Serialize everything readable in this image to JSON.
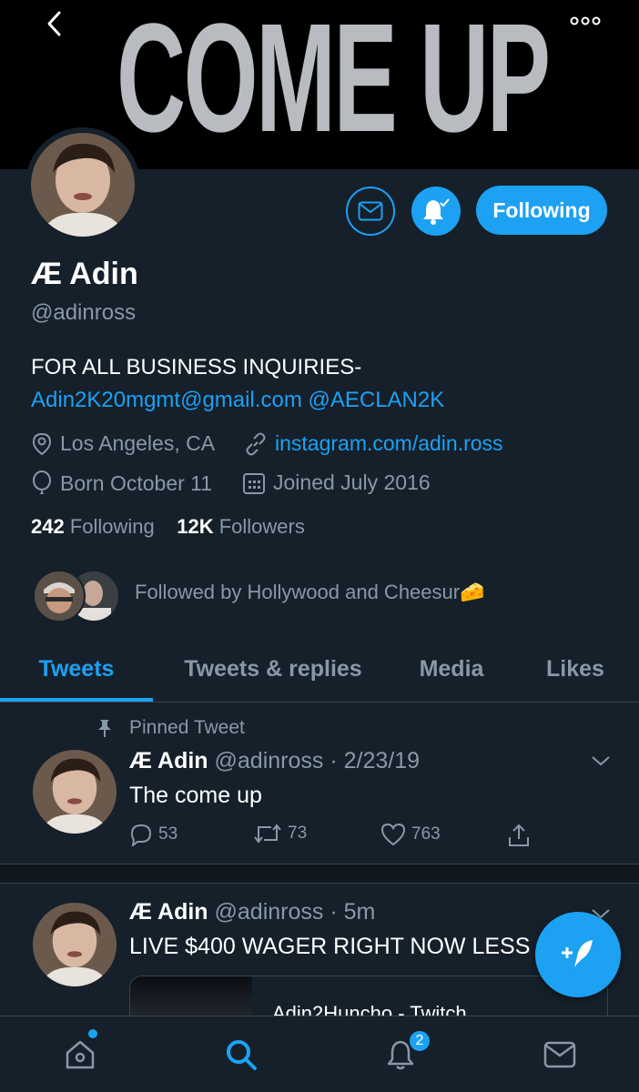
{
  "banner": {
    "text": "COME UP"
  },
  "profile": {
    "name": "Æ Adin",
    "handle": "@adinross",
    "follow_label": "Following",
    "bio_line1": "FOR ALL BUSINESS INQUIRIES-",
    "bio_email": "Adin2K20mgmt@gmail.com",
    "bio_mention": "@AECLAN2K",
    "location": "Los Angeles, CA",
    "website": "instagram.com/adin.ross",
    "birthday": "Born October 11",
    "joined": "Joined July 2016",
    "following_count": "242",
    "following_label": "Following",
    "followers_count": "12K",
    "followers_label": "Followers",
    "followed_by": "Followed by Hollywood and Cheesur🧀"
  },
  "tabs": [
    {
      "label": "Tweets"
    },
    {
      "label": "Tweets & replies"
    },
    {
      "label": "Media"
    },
    {
      "label": "Likes"
    }
  ],
  "tweets": [
    {
      "pinned_label": "Pinned Tweet",
      "name": "Æ Adin",
      "handle_time": "@adinross · 2/23/19",
      "text": "The come up",
      "replies": "53",
      "retweets": "73",
      "likes": "763"
    },
    {
      "name": "Æ Adin",
      "handle_time": "@adinross · 5m",
      "text": "LIVE $400 WAGER RIGHT NOW LESS",
      "card_title": "Adin2Huncho - Twitch"
    }
  ],
  "bottom_nav": {
    "notifications_badge": "2"
  },
  "colors": {
    "accent": "#1da1f2",
    "background": "#15202b",
    "secondary_text": "#8899a6"
  }
}
